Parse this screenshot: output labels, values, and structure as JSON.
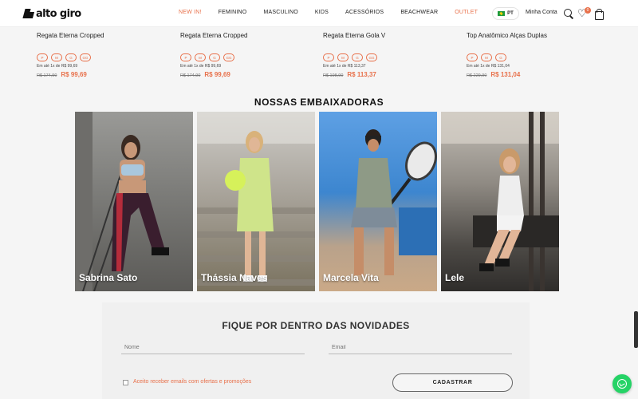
{
  "header": {
    "logo_text": "alto giro",
    "nav": [
      {
        "label": "NEW IN!",
        "accent": true
      },
      {
        "label": "FEMININO",
        "accent": false
      },
      {
        "label": "MASCULINO",
        "accent": false
      },
      {
        "label": "KIDS",
        "accent": false
      },
      {
        "label": "ACESSÓRIOS",
        "accent": false
      },
      {
        "label": "BEACHWEAR",
        "accent": false
      },
      {
        "label": "OUTLET",
        "accent": true
      }
    ],
    "language": "PT",
    "account_label": "Minha Conta",
    "wishlist_count": "0"
  },
  "products": [
    {
      "name": "Regata Eterna Cropped",
      "sizes": [
        "P",
        "M",
        "G",
        "GG"
      ],
      "installment": "Em até 1x de R$ 99,69",
      "old_price": "R$ 174,90",
      "price": "R$ 99,69"
    },
    {
      "name": "Regata Eterna Cropped",
      "sizes": [
        "P",
        "M",
        "G",
        "GG"
      ],
      "installment": "Em até 1x de R$ 99,69",
      "old_price": "R$ 174,90",
      "price": "R$ 99,69"
    },
    {
      "name": "Regata Eterna Gola V",
      "sizes": [
        "P",
        "M",
        "G",
        "GG"
      ],
      "installment": "Em até 1x de R$ 113,37",
      "old_price": "R$ 198,90",
      "price": "R$ 113,37"
    },
    {
      "name": "Top Anatômico Alças Duplas",
      "sizes": [
        "P",
        "M",
        "G"
      ],
      "installment": "Em até 1x de R$ 131,04",
      "old_price": "R$ 229,90",
      "price": "R$ 131,04"
    }
  ],
  "ambassadors": {
    "title": "NOSSAS EMBAIXADORAS",
    "items": [
      {
        "name": "Sabrina Sato"
      },
      {
        "name": "Thássia Naves"
      },
      {
        "name": "Marcela Vita"
      },
      {
        "name": "Lele"
      }
    ]
  },
  "newsletter": {
    "title": "FIQUE POR DENTRO DAS NOVIDADES",
    "name_placeholder": "Nome",
    "email_placeholder": "Email",
    "consent_label": "Aceito receber emails com ofertas e promoções",
    "submit_label": "CADASTRAR"
  },
  "colors": {
    "accent": "#e8704a",
    "whatsapp": "#25d366"
  }
}
